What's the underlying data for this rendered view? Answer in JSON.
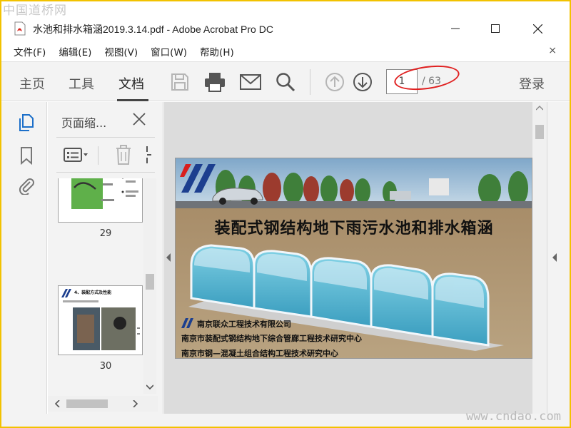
{
  "watermarks": {
    "top": "中国道桥网",
    "bottom": "www.cndao.com"
  },
  "window": {
    "title": "水池和排水箱涵2019.3.14.pdf - Adobe Acrobat Pro DC",
    "controls": {
      "minimize": "—",
      "maximize": "☐",
      "close": "✕"
    }
  },
  "menu": {
    "items": [
      "文件(F)",
      "编辑(E)",
      "视图(V)",
      "窗口(W)",
      "帮助(H)"
    ],
    "close": "×"
  },
  "toolbar": {
    "tabs": [
      "主页",
      "工具",
      "文档"
    ],
    "active_tab": "文档",
    "icons": [
      "save-icon",
      "print-icon",
      "email-icon",
      "search-icon",
      "page-up-icon",
      "page-down-icon"
    ],
    "page_current": "1",
    "page_total": "/ 63",
    "login": "登录"
  },
  "panel": {
    "title": "页面缩...",
    "thumbnails": [
      {
        "label": "29"
      },
      {
        "label": "30",
        "heading": "4、装配方式及性能"
      }
    ]
  },
  "slide": {
    "title": "装配式钢结构地下雨污水池和排水箱涵",
    "company": "南京联众工程技术有限公司",
    "org_lines": [
      "南京市装配式钢结构地下综合管廊工程技术研究中心",
      "南京市钢—混凝土组合结构工程技术研究中心"
    ]
  },
  "colors": {
    "accent": "#1c6fc9",
    "annotation": "#e02020",
    "frame": "#f2c200"
  }
}
